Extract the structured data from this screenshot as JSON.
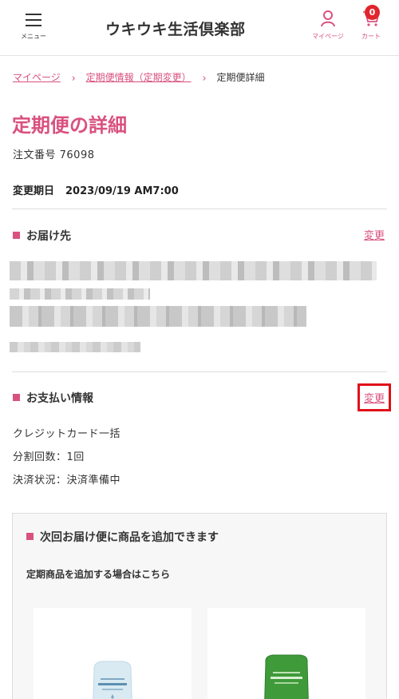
{
  "header": {
    "menu_label": "メニュー",
    "logo_text": "ウキウキ生活倶楽部",
    "mypage_label": "マイページ",
    "cart_label": "カート",
    "cart_count": "0"
  },
  "breadcrumb": {
    "items": [
      "マイページ",
      "定期便情報（定期変更）"
    ],
    "current": "定期便詳細",
    "separator": "›"
  },
  "page": {
    "title": "定期便の詳細",
    "order_number": "注文番号 76098",
    "change_deadline_label": "変更期日",
    "change_deadline_value": "2023/09/19 AM7:00"
  },
  "delivery": {
    "title": "お届け先",
    "change_label": "変更"
  },
  "payment": {
    "title": "お支払い情報",
    "change_label": "変更",
    "method": "クレジットカード一括",
    "installments": "分割回数：1回",
    "status": "決済状況：決済準備中"
  },
  "add_products": {
    "title": "次回お届け便に商品を追加できます",
    "subtitle": "定期商品を追加する場合はこちら"
  },
  "colors": {
    "accent": "#d9517f",
    "badge": "#e0252d",
    "highlight_box": "#e0101a"
  }
}
